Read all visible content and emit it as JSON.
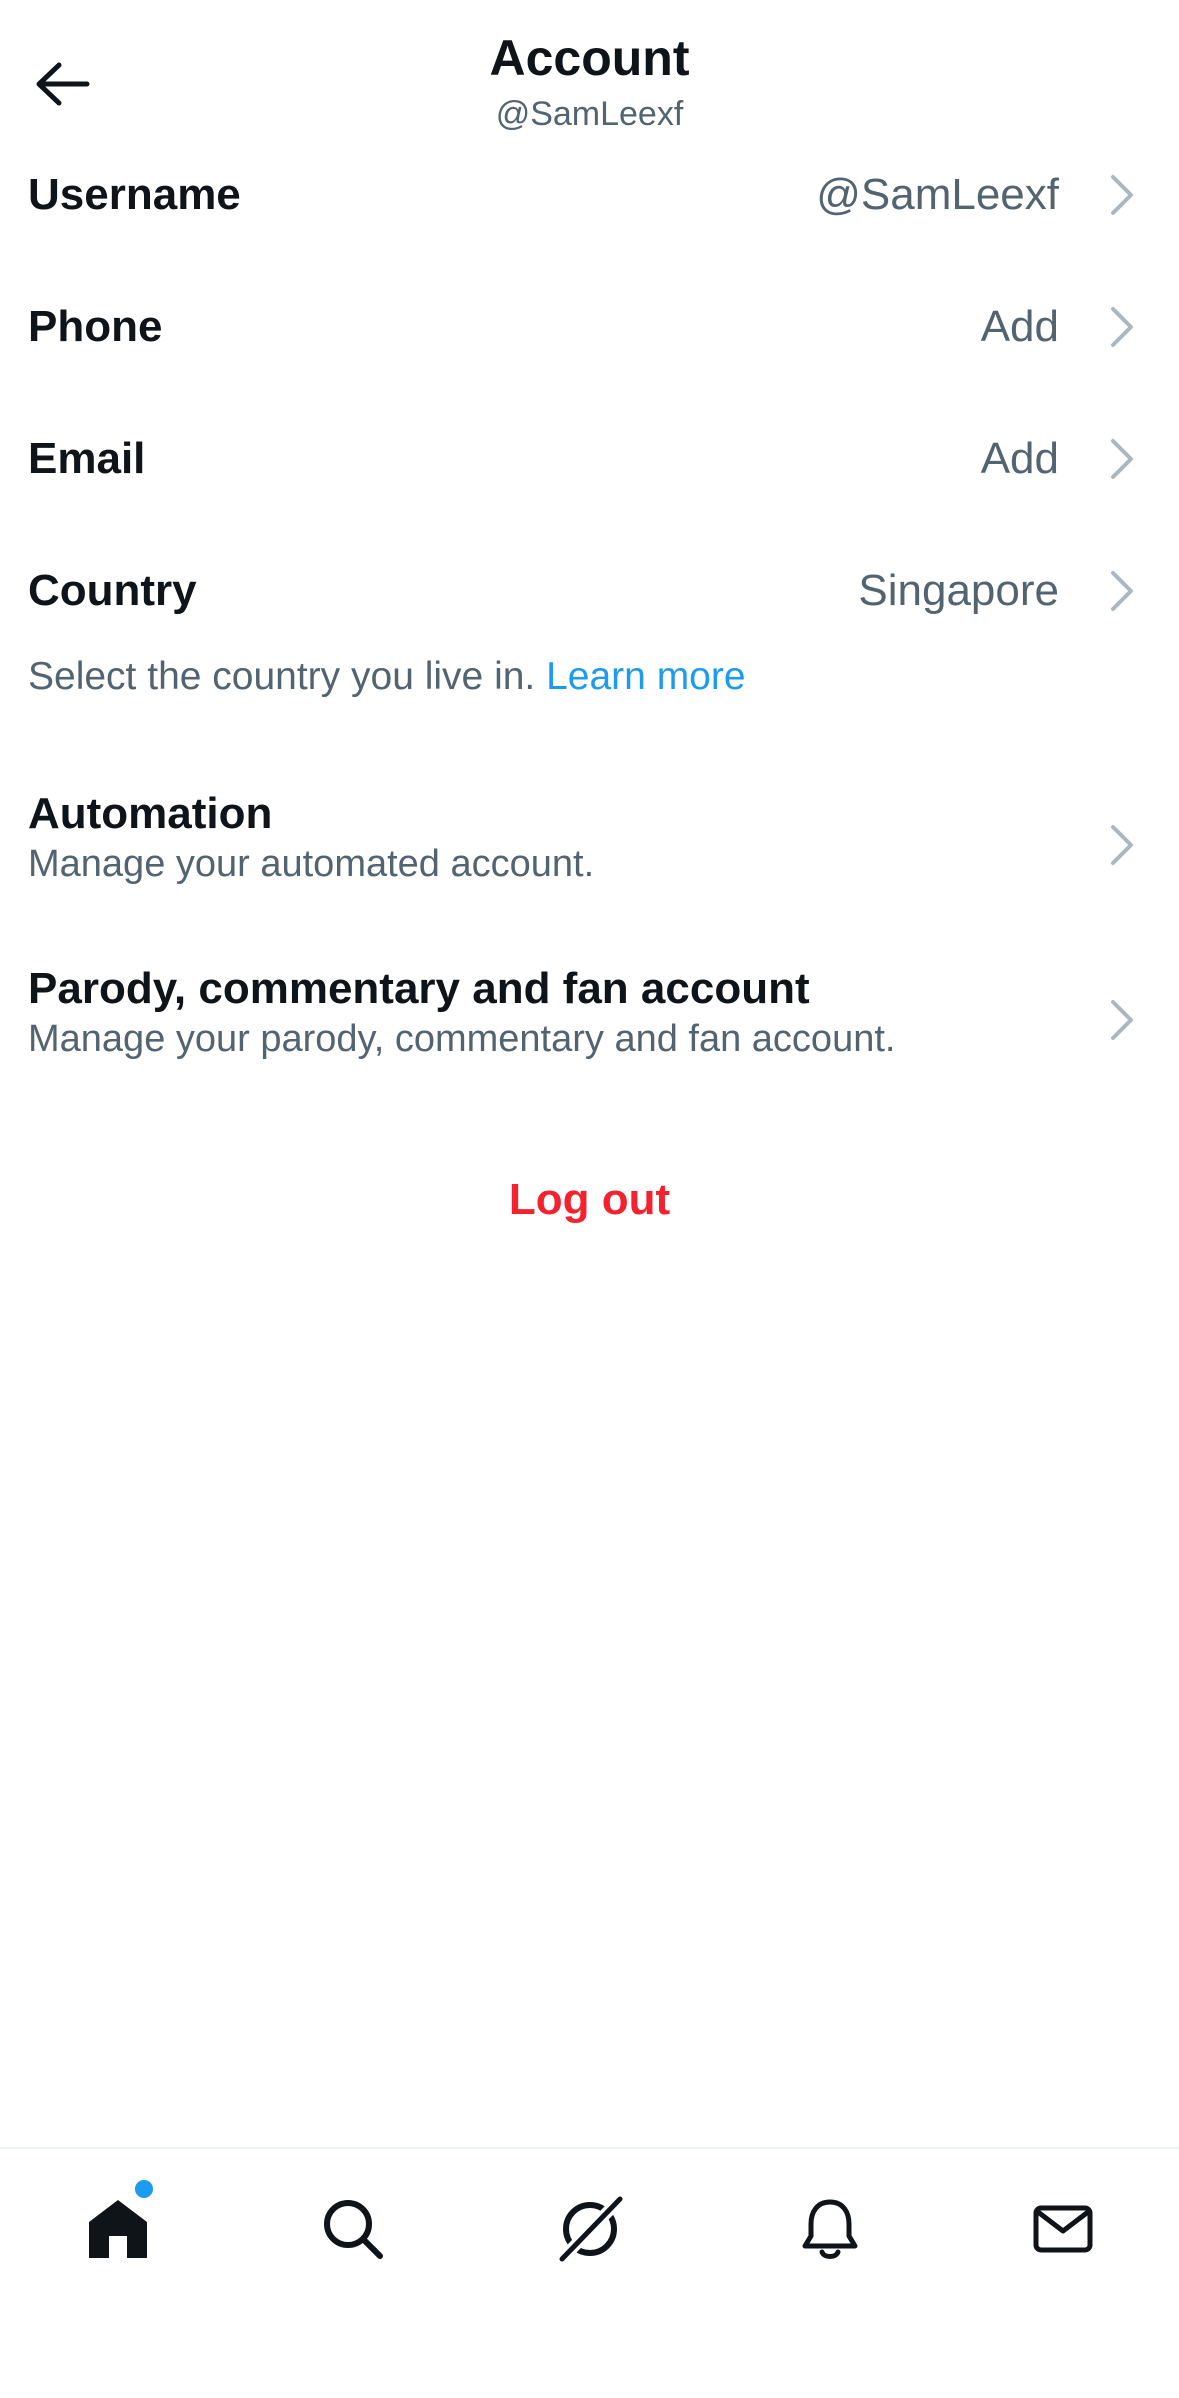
{
  "header": {
    "title": "Account",
    "subtitle": "@SamLeexf",
    "back_icon": "arrow-left-icon"
  },
  "rows": [
    {
      "label": "Username",
      "value": "@SamLeexf"
    },
    {
      "label": "Phone",
      "value": "Add"
    },
    {
      "label": "Email",
      "value": "Add"
    },
    {
      "label": "Country",
      "value": "Singapore"
    }
  ],
  "country_help": {
    "text": "Select the country you live in. ",
    "link": "Learn more"
  },
  "automation": {
    "label": "Automation",
    "sub": "Manage your automated account."
  },
  "parody": {
    "label": "Parody, commentary and fan account",
    "sub": "Manage your parody, commentary and fan account."
  },
  "logout_label": "Log out",
  "bottom_nav": {
    "items": [
      "home-icon",
      "search-icon",
      "grok-icon",
      "bell-icon",
      "mail-icon"
    ],
    "home_has_notification": true
  },
  "colors": {
    "text_primary": "#0f1419",
    "text_secondary": "#536471",
    "link": "#1d9bf0",
    "danger": "#f4212e",
    "chevron": "#aab8c2"
  }
}
